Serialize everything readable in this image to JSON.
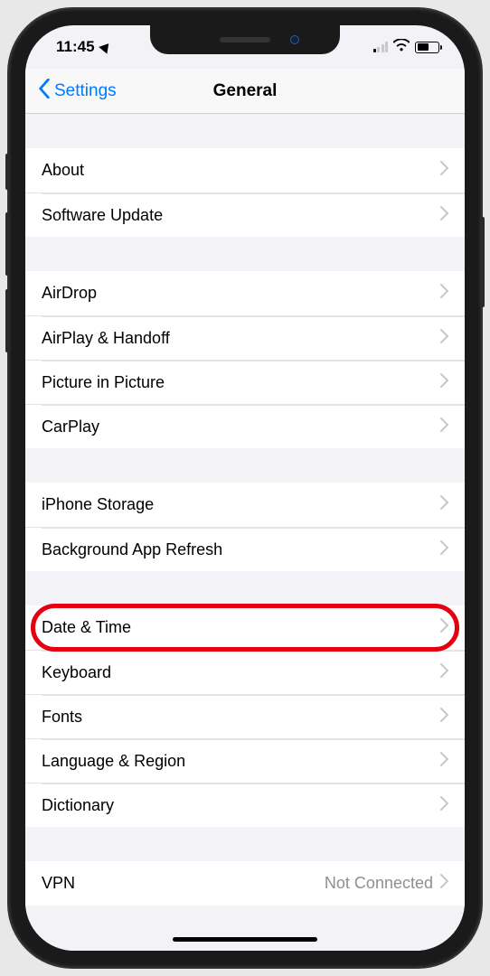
{
  "status": {
    "time": "11:45",
    "signal_active_bars": 1
  },
  "nav": {
    "back_label": "Settings",
    "title": "General"
  },
  "groups": [
    {
      "items": [
        {
          "key": "about",
          "label": "About"
        },
        {
          "key": "software-update",
          "label": "Software Update"
        }
      ]
    },
    {
      "items": [
        {
          "key": "airdrop",
          "label": "AirDrop"
        },
        {
          "key": "airplay-handoff",
          "label": "AirPlay & Handoff"
        },
        {
          "key": "picture-in-picture",
          "label": "Picture in Picture"
        },
        {
          "key": "carplay",
          "label": "CarPlay"
        }
      ]
    },
    {
      "items": [
        {
          "key": "iphone-storage",
          "label": "iPhone Storage"
        },
        {
          "key": "background-app-refresh",
          "label": "Background App Refresh"
        }
      ]
    },
    {
      "items": [
        {
          "key": "date-time",
          "label": "Date & Time",
          "highlight": true
        },
        {
          "key": "keyboard",
          "label": "Keyboard"
        },
        {
          "key": "fonts",
          "label": "Fonts"
        },
        {
          "key": "language-region",
          "label": "Language & Region"
        },
        {
          "key": "dictionary",
          "label": "Dictionary"
        }
      ]
    },
    {
      "items": [
        {
          "key": "vpn",
          "label": "VPN",
          "detail": "Not Connected"
        }
      ]
    }
  ]
}
